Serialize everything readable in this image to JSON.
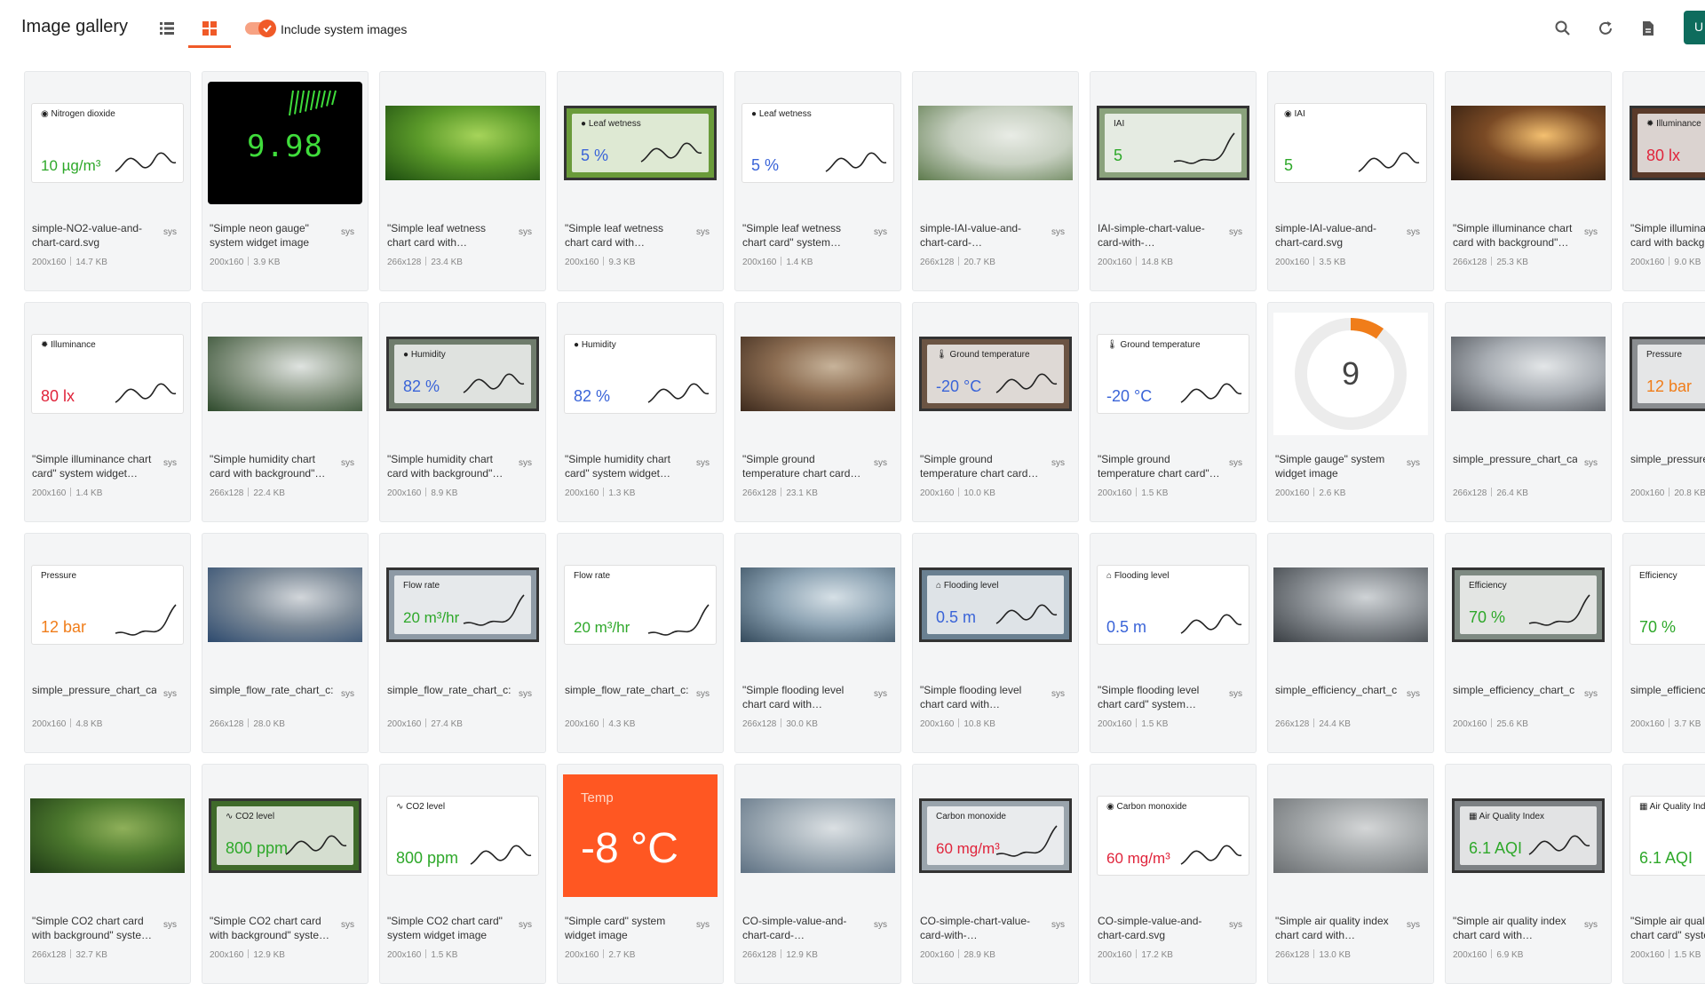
{
  "header": {
    "title": "Image gallery",
    "toggle_label": "Include system images",
    "upload_label": "U"
  },
  "colors": {
    "accent": "#f05a28",
    "primary": "#0e6c5d",
    "green": "#2ea82a",
    "red": "#e0243b",
    "blue": "#3a64d8",
    "orange": "#f07d1a"
  },
  "cards": [
    {
      "name": "simple-NO2-value-and-chart-card.svg",
      "badge": "sys",
      "dims": "200x160",
      "size": "14.7 KB",
      "thumb": {
        "kind": "widget",
        "style": "plain",
        "label": "Nitrogen dioxide",
        "icon": "circle-icon",
        "value": "10 µg/m³",
        "color": "#2ea82a",
        "spark": "wave"
      }
    },
    {
      "name": "\"Simple neon gauge\" system widget image",
      "badge": "sys",
      "dims": "200x160",
      "size": "3.9 KB",
      "thumb": {
        "kind": "neon",
        "value": "9.98"
      }
    },
    {
      "name": "\"Simple leaf wetness chart card with…",
      "badge": "sys",
      "dims": "266x128",
      "size": "23.4 KB",
      "thumb": {
        "kind": "photo",
        "palette": [
          "#1d4d10",
          "#5c9b2a",
          "#a6d45a"
        ]
      }
    },
    {
      "name": "\"Simple leaf wetness chart card with…",
      "badge": "sys",
      "dims": "200x160",
      "size": "9.3 KB",
      "thumb": {
        "kind": "widget",
        "style": "bg",
        "label": "Leaf wetness",
        "icon": "drop-icon",
        "value": "5 %",
        "color": "#3a64d8",
        "spark": "wave",
        "bgcolor": "#6a9b3a"
      }
    },
    {
      "name": "\"Simple leaf wetness chart card\" system…",
      "badge": "sys",
      "dims": "200x160",
      "size": "1.4 KB",
      "thumb": {
        "kind": "widget",
        "style": "plain",
        "label": "Leaf wetness",
        "icon": "drop-icon",
        "value": "5 %",
        "color": "#3a64d8",
        "spark": "wave"
      }
    },
    {
      "name": "simple-IAI-value-and-chart-card-…",
      "badge": "sys",
      "dims": "266x128",
      "size": "20.7 KB",
      "thumb": {
        "kind": "photo",
        "palette": [
          "#5d7a4c",
          "#c6cfc0",
          "#e9ece6"
        ]
      }
    },
    {
      "name": "IAI-simple-chart-value-card-with-…",
      "badge": "sys",
      "dims": "200x160",
      "size": "14.8 KB",
      "thumb": {
        "kind": "widget",
        "style": "bg",
        "label": "IAI",
        "icon": "",
        "value": "5",
        "color": "#2ea82a",
        "spark": "rise",
        "bgcolor": "#8aa27c"
      }
    },
    {
      "name": "simple-IAI-value-and-chart-card.svg",
      "badge": "sys",
      "dims": "200x160",
      "size": "3.5 KB",
      "thumb": {
        "kind": "widget",
        "style": "plain",
        "label": "IAI",
        "icon": "circle-icon",
        "value": "5",
        "color": "#2ea82a",
        "spark": "wave"
      }
    },
    {
      "name": "\"Simple illuminance chart card with background\"…",
      "badge": "sys",
      "dims": "266x128",
      "size": "25.3 KB",
      "thumb": {
        "kind": "photo",
        "palette": [
          "#2b1a0f",
          "#7a4a25",
          "#f4c070"
        ]
      }
    },
    {
      "name": "\"Simple illuminance chart card with backgr…",
      "badge": "sys",
      "dims": "200x160",
      "size": "9.0 KB",
      "thumb": {
        "kind": "widget",
        "style": "bg",
        "label": "Illuminance",
        "icon": "sun-icon",
        "value": "80 lx",
        "color": "#e0243b",
        "spark": "wave",
        "bgcolor": "#5a3a2a"
      }
    },
    {
      "name": "\"Simple illuminance chart card\" system widget…",
      "badge": "sys",
      "dims": "200x160",
      "size": "1.4 KB",
      "thumb": {
        "kind": "widget",
        "style": "plain",
        "label": "Illuminance",
        "icon": "sun-icon",
        "value": "80 lx",
        "color": "#e0243b",
        "spark": "wave"
      }
    },
    {
      "name": "\"Simple humidity chart card with background\"…",
      "badge": "sys",
      "dims": "266x128",
      "size": "22.4 KB",
      "thumb": {
        "kind": "photo",
        "palette": [
          "#2e4a2c",
          "#8f9c8a",
          "#dfe3e0"
        ]
      }
    },
    {
      "name": "\"Simple humidity chart card with background\"…",
      "badge": "sys",
      "dims": "200x160",
      "size": "8.9 KB",
      "thumb": {
        "kind": "widget",
        "style": "bg",
        "label": "Humidity",
        "icon": "drop-icon",
        "value": "82 %",
        "color": "#3a64d8",
        "spark": "wave",
        "bgcolor": "#6f7c6c"
      }
    },
    {
      "name": "\"Simple humidity chart card\" system widget…",
      "badge": "sys",
      "dims": "200x160",
      "size": "1.3 KB",
      "thumb": {
        "kind": "widget",
        "style": "plain",
        "label": "Humidity",
        "icon": "drop-icon",
        "value": "82 %",
        "color": "#3a64d8",
        "spark": "wave"
      }
    },
    {
      "name": "\"Simple ground temperature chart card…",
      "badge": "sys",
      "dims": "266x128",
      "size": "23.1 KB",
      "thumb": {
        "kind": "photo",
        "palette": [
          "#3d2a1d",
          "#8c6d52",
          "#c7b39a"
        ]
      }
    },
    {
      "name": "\"Simple ground temperature chart card…",
      "badge": "sys",
      "dims": "200x160",
      "size": "10.0 KB",
      "thumb": {
        "kind": "widget",
        "style": "bg",
        "label": "Ground temperature",
        "icon": "thermometer-icon",
        "value": "-20 °C",
        "color": "#3a64d8",
        "spark": "wave",
        "bgcolor": "#6b5443"
      }
    },
    {
      "name": "\"Simple ground temperature chart card\"…",
      "badge": "sys",
      "dims": "200x160",
      "size": "1.5 KB",
      "thumb": {
        "kind": "widget",
        "style": "plain",
        "label": "Ground temperature",
        "icon": "thermometer-icon",
        "value": "-20 °C",
        "color": "#3a64d8",
        "spark": "wave"
      }
    },
    {
      "name": "\"Simple gauge\" system widget image",
      "badge": "sys",
      "dims": "200x160",
      "size": "2.6 KB",
      "thumb": {
        "kind": "gauge",
        "value": "9",
        "fraction": 0.1
      }
    },
    {
      "name": "simple_pressure_chart_ca",
      "badge": "sys",
      "dims": "266x128",
      "size": "26.4 KB",
      "thumb": {
        "kind": "photo",
        "palette": [
          "#4b4f55",
          "#a8adb3",
          "#e3e6e8"
        ]
      }
    },
    {
      "name": "simple_pressure_…",
      "badge": "",
      "dims": "200x160",
      "size": "20.8 KB",
      "thumb": {
        "kind": "widget",
        "style": "bg",
        "label": "Pressure",
        "icon": "",
        "value": "12 bar",
        "color": "#f07d1a",
        "spark": "rise",
        "bgcolor": "#8a8d90"
      }
    },
    {
      "name": "simple_pressure_chart_ca",
      "badge": "sys",
      "dims": "200x160",
      "size": "4.8 KB",
      "thumb": {
        "kind": "widget",
        "style": "plain",
        "label": "Pressure",
        "icon": "",
        "value": "12 bar",
        "color": "#f07d1a",
        "spark": "rise"
      }
    },
    {
      "name": "simple_flow_rate_chart_c:",
      "badge": "sys",
      "dims": "266x128",
      "size": "28.0 KB",
      "thumb": {
        "kind": "photo",
        "palette": [
          "#2d4a6e",
          "#7f8c99",
          "#d2d6da"
        ]
      }
    },
    {
      "name": "simple_flow_rate_chart_c:",
      "badge": "sys",
      "dims": "200x160",
      "size": "27.4 KB",
      "thumb": {
        "kind": "widget",
        "style": "bg",
        "label": "Flow rate",
        "icon": "",
        "value": "20 m³/hr",
        "color": "#2ea82a",
        "spark": "rise",
        "bgcolor": "#8e9aa5"
      }
    },
    {
      "name": "simple_flow_rate_chart_c:",
      "badge": "sys",
      "dims": "200x160",
      "size": "4.3 KB",
      "thumb": {
        "kind": "widget",
        "style": "plain",
        "label": "Flow rate",
        "icon": "",
        "value": "20 m³/hr",
        "color": "#2ea82a",
        "spark": "rise"
      }
    },
    {
      "name": "\"Simple flooding level chart card with…",
      "badge": "sys",
      "dims": "266x128",
      "size": "30.0 KB",
      "thumb": {
        "kind": "photo",
        "palette": [
          "#344a5c",
          "#8da3b3",
          "#d6e0e6"
        ]
      }
    },
    {
      "name": "\"Simple flooding level chart card with…",
      "badge": "sys",
      "dims": "200x160",
      "size": "10.8 KB",
      "thumb": {
        "kind": "widget",
        "style": "bg",
        "label": "Flooding level",
        "icon": "house-icon",
        "value": "0.5 m",
        "color": "#3a64d8",
        "spark": "wave",
        "bgcolor": "#6a8091"
      }
    },
    {
      "name": "\"Simple flooding level chart card\" system…",
      "badge": "sys",
      "dims": "200x160",
      "size": "1.5 KB",
      "thumb": {
        "kind": "widget",
        "style": "plain",
        "label": "Flooding level",
        "icon": "house-icon",
        "value": "0.5 m",
        "color": "#3a64d8",
        "spark": "wave"
      }
    },
    {
      "name": "simple_efficiency_chart_c",
      "badge": "sys",
      "dims": "266x128",
      "size": "24.4 KB",
      "thumb": {
        "kind": "photo",
        "palette": [
          "#3a3f44",
          "#8b9095",
          "#cfd3d6"
        ]
      }
    },
    {
      "name": "simple_efficiency_chart_c",
      "badge": "sys",
      "dims": "200x160",
      "size": "25.6 KB",
      "thumb": {
        "kind": "widget",
        "style": "bg",
        "label": "Efficiency",
        "icon": "",
        "value": "70 %",
        "color": "#2ea82a",
        "spark": "rise",
        "bgcolor": "#7e8a82"
      }
    },
    {
      "name": "simple_efficiency…",
      "badge": "",
      "dims": "200x160",
      "size": "3.7 KB",
      "thumb": {
        "kind": "widget",
        "style": "plain",
        "label": "Efficiency",
        "icon": "",
        "value": "70 %",
        "color": "#2ea82a",
        "spark": "rise"
      }
    },
    {
      "name": "\"Simple CO2 chart card with background\" syste…",
      "badge": "sys",
      "dims": "266x128",
      "size": "32.7 KB",
      "thumb": {
        "kind": "photo",
        "palette": [
          "#1f3a16",
          "#4d7a2e",
          "#8fb05a"
        ]
      }
    },
    {
      "name": "\"Simple CO2 chart card with background\" syste…",
      "badge": "sys",
      "dims": "200x160",
      "size": "12.9 KB",
      "thumb": {
        "kind": "widget",
        "style": "bg",
        "label": "CO2 level",
        "icon": "co2-icon",
        "value": "800 ppm",
        "color": "#2ea82a",
        "spark": "wave",
        "bgcolor": "#3f6a2a"
      }
    },
    {
      "name": "\"Simple CO2 chart card\" system widget image",
      "badge": "sys",
      "dims": "200x160",
      "size": "1.5 KB",
      "thumb": {
        "kind": "widget",
        "style": "plain",
        "label": "CO2 level",
        "icon": "co2-icon",
        "value": "800 ppm",
        "color": "#2ea82a",
        "spark": "wave"
      }
    },
    {
      "name": "\"Simple card\" system widget image",
      "badge": "sys",
      "dims": "200x160",
      "size": "2.7 KB",
      "thumb": {
        "kind": "temp",
        "label": "Temp",
        "value": "-8 °C"
      }
    },
    {
      "name": "CO-simple-value-and-chart-card-…",
      "badge": "sys",
      "dims": "266x128",
      "size": "12.9 KB",
      "thumb": {
        "kind": "photo",
        "palette": [
          "#5e7183",
          "#a3afb8",
          "#dbe0e3"
        ]
      }
    },
    {
      "name": "CO-simple-chart-value-card-with-…",
      "badge": "sys",
      "dims": "200x160",
      "size": "28.9 KB",
      "thumb": {
        "kind": "widget",
        "style": "bg",
        "label": "Carbon monoxide",
        "icon": "",
        "value": "60 mg/m³",
        "color": "#e0243b",
        "spark": "rise",
        "bgcolor": "#9aa4ac"
      }
    },
    {
      "name": "CO-simple-value-and-chart-card.svg",
      "badge": "sys",
      "dims": "200x160",
      "size": "17.2 KB",
      "thumb": {
        "kind": "widget",
        "style": "plain",
        "label": "Carbon monoxide",
        "icon": "circle-icon",
        "value": "60 mg/m³",
        "color": "#e0243b",
        "spark": "wave"
      }
    },
    {
      "name": "\"Simple air quality index chart card with…",
      "badge": "sys",
      "dims": "266x128",
      "size": "13.0 KB",
      "thumb": {
        "kind": "photo",
        "palette": [
          "#6b6f72",
          "#a3a7a9",
          "#d4d6d7"
        ]
      }
    },
    {
      "name": "\"Simple air quality index chart card with…",
      "badge": "sys",
      "dims": "200x160",
      "size": "6.9 KB",
      "thumb": {
        "kind": "widget",
        "style": "bg",
        "label": "Air Quality Index",
        "icon": "building-icon",
        "value": "6.1 AQI",
        "color": "#2ea82a",
        "spark": "wave",
        "bgcolor": "#7d8184"
      }
    },
    {
      "name": "\"Simple air quality index chart card\" syste…",
      "badge": "",
      "dims": "200x160",
      "size": "1.5 KB",
      "thumb": {
        "kind": "widget",
        "style": "plain",
        "label": "Air Quality Index",
        "icon": "building-icon",
        "value": "6.1 AQI",
        "color": "#2ea82a",
        "spark": "wave"
      }
    }
  ]
}
